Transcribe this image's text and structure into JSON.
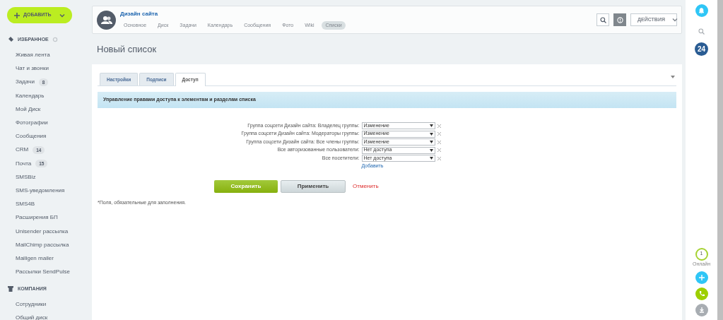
{
  "sidebar": {
    "add_button": "ДОБАВИТЬ",
    "sections": [
      {
        "title": "ИЗБРАННОЕ",
        "settings": true,
        "items": [
          {
            "label": "Живая лента"
          },
          {
            "label": "Чат и звонки"
          },
          {
            "label": "Задачи",
            "count": "8"
          },
          {
            "label": "Календарь"
          },
          {
            "label": "Мой Диск"
          },
          {
            "label": "Фотографии"
          },
          {
            "label": "Сообщения"
          },
          {
            "label": "CRM",
            "count": "14"
          },
          {
            "label": "Почта",
            "count": "15"
          },
          {
            "label": "SMSBiz"
          },
          {
            "label": "SMS-уведомления"
          },
          {
            "label": "SMS4B"
          },
          {
            "label": "Расширения БП"
          },
          {
            "label": "Unisender рассылка"
          },
          {
            "label": "MailChimp рассылка"
          },
          {
            "label": "Mailigen mailer"
          },
          {
            "label": "Рассылки SendPulse"
          }
        ]
      },
      {
        "title": "КОМПАНИЯ",
        "settings": false,
        "items": [
          {
            "label": "Сотрудники"
          },
          {
            "label": "Общий диск"
          }
        ]
      }
    ]
  },
  "group_header": {
    "title": "Дизайн сайта",
    "tabs": [
      {
        "label": "Основное",
        "selected": false
      },
      {
        "label": "Диск",
        "selected": false
      },
      {
        "label": "Задачи",
        "selected": false
      },
      {
        "label": "Календарь",
        "selected": false
      },
      {
        "label": "Сообщения",
        "selected": false
      },
      {
        "label": "Фото",
        "selected": false
      },
      {
        "label": "Wiki",
        "selected": false
      },
      {
        "label": "Списки",
        "selected": true
      }
    ],
    "actions_button": "ДЕЙСТВИЯ"
  },
  "page_title": "Новый список",
  "form_tabs": [
    {
      "label": "Настройки",
      "selected": false
    },
    {
      "label": "Подписи",
      "selected": false
    },
    {
      "label": "Доступ",
      "selected": true
    }
  ],
  "info_bar": "Управление правами доступа к элементам и разделам списка",
  "permissions": [
    {
      "label": "Группа соцсети Дизайн сайта: Владелец группы:",
      "value": "Изменение"
    },
    {
      "label": "Группа соцсети Дизайн сайта: Модераторы группы:",
      "value": "Изменение"
    },
    {
      "label": "Группа соцсети Дизайн сайта: Все члены группы:",
      "value": "Изменение"
    },
    {
      "label": "Все авторизованные пользователи:",
      "value": "Нет доступа"
    },
    {
      "label": "Все посетители:",
      "value": "Нет доступа"
    }
  ],
  "add_link": "Добавить",
  "buttons": {
    "save": "Сохранить",
    "apply": "Применить",
    "cancel": "Отменить"
  },
  "required_note": "*Поля, обязательные для заполнения.",
  "right_bar": {
    "badge": "24",
    "online_count": "1",
    "online_label": "Онлайн"
  }
}
